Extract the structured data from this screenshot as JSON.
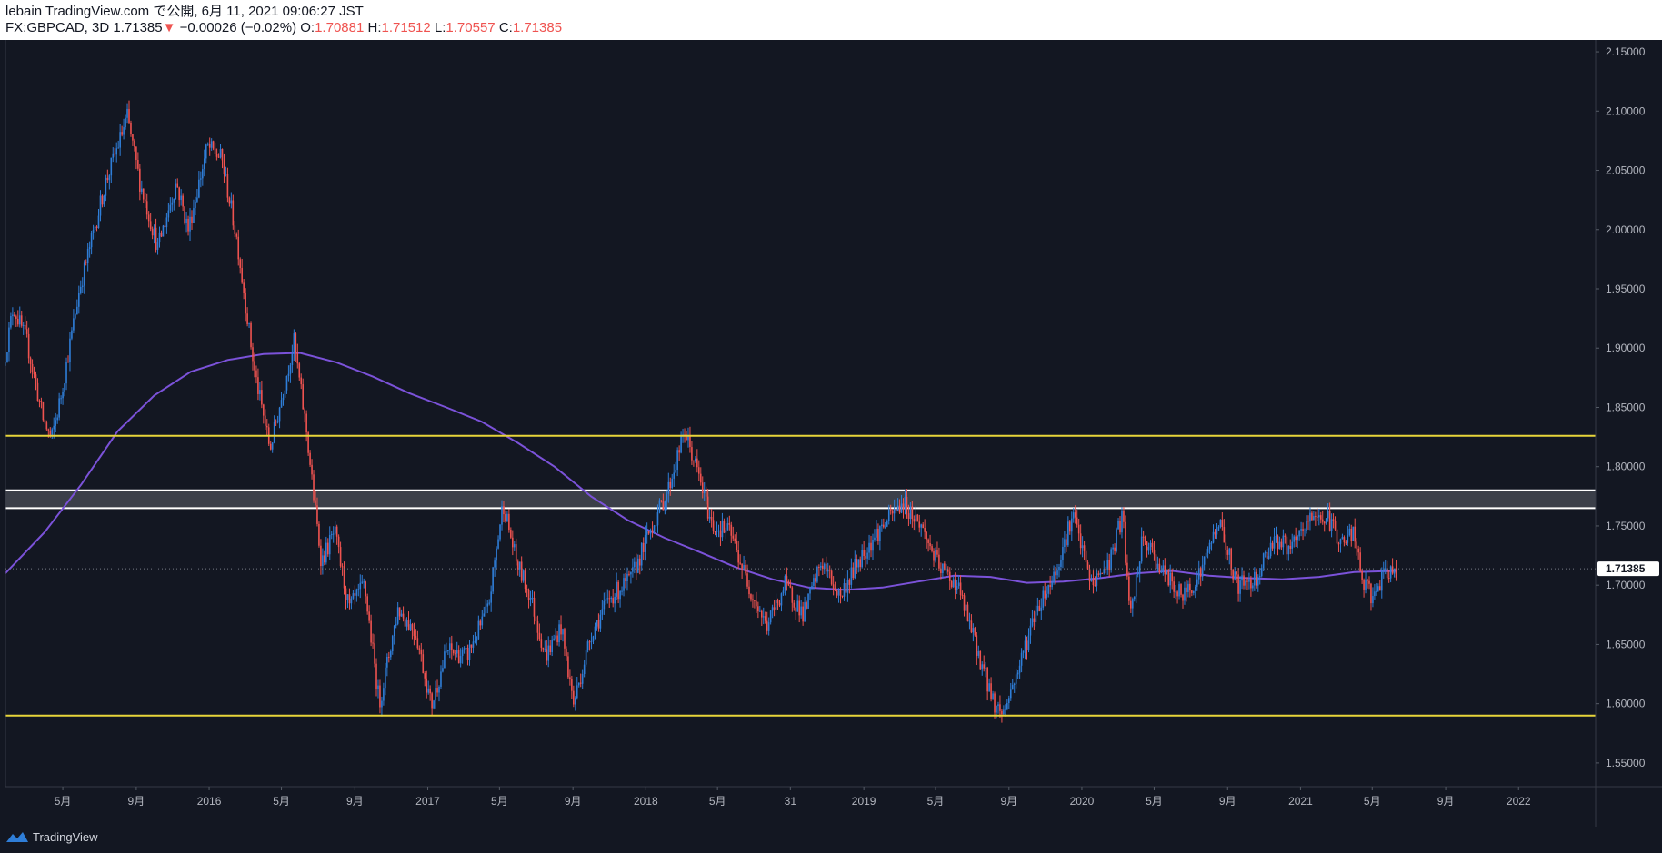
{
  "header": {
    "publisher": "lebain TradingView.com で公開, 6月 11, 2021 09:06:27 JST",
    "symbol": "FX:GBPCAD, 3D",
    "last": "1.71385",
    "change": "−0.00026 (−0.02%)",
    "open_label": "O:",
    "open": "1.70881",
    "high_label": "H:",
    "high": "1.71512",
    "low_label": "L:",
    "low": "1.70557",
    "close_label": "C:",
    "close": "1.71385"
  },
  "footer": {
    "brand": "TradingView",
    "logo_icon": "tradingview-logo-icon"
  },
  "colors": {
    "background": "#131722",
    "up": "#2f7ed8",
    "down": "#ef5350",
    "ma": "#7b52d9",
    "support_resistance": "#e8d53a",
    "zone_border": "#ffffff",
    "zone_fill": "#4a4d57",
    "price_tag": "#ffffff"
  },
  "chart_data": {
    "type": "candlestick",
    "symbol": "FX:GBPCAD",
    "timeframe": "3D",
    "ylim": [
      1.53,
      2.16
    ],
    "xlim": [
      "2015-01-25",
      "2022-05-10"
    ],
    "y_ticks": [
      "1.55000",
      "1.60000",
      "1.65000",
      "1.70000",
      "1.75000",
      "1.80000",
      "1.85000",
      "1.90000",
      "1.95000",
      "2.00000",
      "2.05000",
      "2.10000",
      "2.15000"
    ],
    "x_ticks": [
      {
        "label": "5月",
        "date": "2015-05-01"
      },
      {
        "label": "9月",
        "date": "2015-09-01"
      },
      {
        "label": "2016",
        "date": "2016-01-01"
      },
      {
        "label": "5月",
        "date": "2016-05-01"
      },
      {
        "label": "9月",
        "date": "2016-09-01"
      },
      {
        "label": "2017",
        "date": "2017-01-01"
      },
      {
        "label": "5月",
        "date": "2017-05-01"
      },
      {
        "label": "9月",
        "date": "2017-09-01"
      },
      {
        "label": "2018",
        "date": "2018-01-01"
      },
      {
        "label": "5月",
        "date": "2018-05-01"
      },
      {
        "label": "31",
        "date": "2018-08-31"
      },
      {
        "label": "2019",
        "date": "2019-01-01"
      },
      {
        "label": "5月",
        "date": "2019-05-01"
      },
      {
        "label": "9月",
        "date": "2019-09-01"
      },
      {
        "label": "2020",
        "date": "2020-01-01"
      },
      {
        "label": "5月",
        "date": "2020-05-01"
      },
      {
        "label": "9月",
        "date": "2020-09-01"
      },
      {
        "label": "2021",
        "date": "2021-01-01"
      },
      {
        "label": "5月",
        "date": "2021-05-01"
      },
      {
        "label": "9月",
        "date": "2021-09-01"
      },
      {
        "label": "2022",
        "date": "2022-01-01"
      }
    ],
    "last_price": 1.71385,
    "last_price_label": "1.71385",
    "price_path": [
      {
        "date": "2015-01-25",
        "price": 1.885
      },
      {
        "date": "2015-02-10",
        "price": 1.935
      },
      {
        "date": "2015-03-05",
        "price": 1.905
      },
      {
        "date": "2015-04-01",
        "price": 1.84
      },
      {
        "date": "2015-04-15",
        "price": 1.823
      },
      {
        "date": "2015-05-01",
        "price": 1.86
      },
      {
        "date": "2015-06-01",
        "price": 1.95
      },
      {
        "date": "2015-07-15",
        "price": 2.04
      },
      {
        "date": "2015-08-20",
        "price": 2.095
      },
      {
        "date": "2015-09-10",
        "price": 2.04
      },
      {
        "date": "2015-10-10",
        "price": 1.985
      },
      {
        "date": "2015-11-10",
        "price": 2.04
      },
      {
        "date": "2015-11-30",
        "price": 2.0
      },
      {
        "date": "2016-01-01",
        "price": 2.07
      },
      {
        "date": "2016-01-25",
        "price": 2.06
      },
      {
        "date": "2016-02-20",
        "price": 1.99
      },
      {
        "date": "2016-03-20",
        "price": 1.88
      },
      {
        "date": "2016-04-15",
        "price": 1.815
      },
      {
        "date": "2016-05-05",
        "price": 1.86
      },
      {
        "date": "2016-05-25",
        "price": 1.905
      },
      {
        "date": "2016-06-15",
        "price": 1.83
      },
      {
        "date": "2016-06-28",
        "price": 1.77
      },
      {
        "date": "2016-07-10",
        "price": 1.72
      },
      {
        "date": "2016-08-01",
        "price": 1.745
      },
      {
        "date": "2016-08-25",
        "price": 1.68
      },
      {
        "date": "2016-09-20",
        "price": 1.7
      },
      {
        "date": "2016-10-15",
        "price": 1.6
      },
      {
        "date": "2016-11-15",
        "price": 1.68
      },
      {
        "date": "2016-12-15",
        "price": 1.66
      },
      {
        "date": "2017-01-10",
        "price": 1.598
      },
      {
        "date": "2017-02-05",
        "price": 1.645
      },
      {
        "date": "2017-03-10",
        "price": 1.64
      },
      {
        "date": "2017-04-15",
        "price": 1.68
      },
      {
        "date": "2017-05-10",
        "price": 1.77
      },
      {
        "date": "2017-06-01",
        "price": 1.72
      },
      {
        "date": "2017-06-25",
        "price": 1.69
      },
      {
        "date": "2017-07-20",
        "price": 1.64
      },
      {
        "date": "2017-08-15",
        "price": 1.665
      },
      {
        "date": "2017-09-05",
        "price": 1.6
      },
      {
        "date": "2017-10-05",
        "price": 1.66
      },
      {
        "date": "2017-11-05",
        "price": 1.69
      },
      {
        "date": "2017-12-10",
        "price": 1.705
      },
      {
        "date": "2018-01-10",
        "price": 1.745
      },
      {
        "date": "2018-02-10",
        "price": 1.78
      },
      {
        "date": "2018-03-10",
        "price": 1.83
      },
      {
        "date": "2018-04-01",
        "price": 1.795
      },
      {
        "date": "2018-04-25",
        "price": 1.75
      },
      {
        "date": "2018-05-25",
        "price": 1.745
      },
      {
        "date": "2018-06-25",
        "price": 1.7
      },
      {
        "date": "2018-07-25",
        "price": 1.665
      },
      {
        "date": "2018-08-25",
        "price": 1.7
      },
      {
        "date": "2018-09-25",
        "price": 1.675
      },
      {
        "date": "2018-10-25",
        "price": 1.72
      },
      {
        "date": "2018-11-25",
        "price": 1.69
      },
      {
        "date": "2018-12-25",
        "price": 1.72
      },
      {
        "date": "2019-01-20",
        "price": 1.74
      },
      {
        "date": "2019-03-10",
        "price": 1.77
      },
      {
        "date": "2019-04-10",
        "price": 1.75
      },
      {
        "date": "2019-05-10",
        "price": 1.715
      },
      {
        "date": "2019-06-10",
        "price": 1.7
      },
      {
        "date": "2019-07-10",
        "price": 1.65
      },
      {
        "date": "2019-08-10",
        "price": 1.6
      },
      {
        "date": "2019-08-25",
        "price": 1.592
      },
      {
        "date": "2019-09-20",
        "price": 1.63
      },
      {
        "date": "2019-10-20",
        "price": 1.68
      },
      {
        "date": "2019-11-20",
        "price": 1.71
      },
      {
        "date": "2019-12-20",
        "price": 1.76
      },
      {
        "date": "2020-01-20",
        "price": 1.7
      },
      {
        "date": "2020-02-20",
        "price": 1.72
      },
      {
        "date": "2020-03-12",
        "price": 1.76
      },
      {
        "date": "2020-03-25",
        "price": 1.67
      },
      {
        "date": "2020-04-15",
        "price": 1.74
      },
      {
        "date": "2020-05-20",
        "price": 1.71
      },
      {
        "date": "2020-06-20",
        "price": 1.69
      },
      {
        "date": "2020-07-20",
        "price": 1.71
      },
      {
        "date": "2020-08-20",
        "price": 1.755
      },
      {
        "date": "2020-09-20",
        "price": 1.7
      },
      {
        "date": "2020-10-20",
        "price": 1.705
      },
      {
        "date": "2020-11-20",
        "price": 1.74
      },
      {
        "date": "2020-12-20",
        "price": 1.73
      },
      {
        "date": "2021-01-25",
        "price": 1.76
      },
      {
        "date": "2021-02-20",
        "price": 1.755
      },
      {
        "date": "2021-03-15",
        "price": 1.735
      },
      {
        "date": "2021-04-01",
        "price": 1.745
      },
      {
        "date": "2021-04-20",
        "price": 1.7
      },
      {
        "date": "2021-05-05",
        "price": 1.69
      },
      {
        "date": "2021-05-20",
        "price": 1.705
      },
      {
        "date": "2021-06-10",
        "price": 1.71385
      }
    ],
    "moving_average": [
      {
        "date": "2015-01-25",
        "price": 1.71
      },
      {
        "date": "2015-04-01",
        "price": 1.745
      },
      {
        "date": "2015-06-01",
        "price": 1.785
      },
      {
        "date": "2015-08-01",
        "price": 1.83
      },
      {
        "date": "2015-10-01",
        "price": 1.86
      },
      {
        "date": "2015-12-01",
        "price": 1.88
      },
      {
        "date": "2016-02-01",
        "price": 1.89
      },
      {
        "date": "2016-04-01",
        "price": 1.895
      },
      {
        "date": "2016-06-01",
        "price": 1.896
      },
      {
        "date": "2016-08-01",
        "price": 1.888
      },
      {
        "date": "2016-10-01",
        "price": 1.876
      },
      {
        "date": "2016-12-01",
        "price": 1.862
      },
      {
        "date": "2017-02-01",
        "price": 1.85
      },
      {
        "date": "2017-04-01",
        "price": 1.838
      },
      {
        "date": "2017-06-01",
        "price": 1.82
      },
      {
        "date": "2017-08-01",
        "price": 1.8
      },
      {
        "date": "2017-10-01",
        "price": 1.775
      },
      {
        "date": "2017-12-01",
        "price": 1.755
      },
      {
        "date": "2018-02-01",
        "price": 1.74
      },
      {
        "date": "2018-04-01",
        "price": 1.728
      },
      {
        "date": "2018-06-01",
        "price": 1.715
      },
      {
        "date": "2018-08-01",
        "price": 1.705
      },
      {
        "date": "2018-10-01",
        "price": 1.698
      },
      {
        "date": "2018-12-01",
        "price": 1.696
      },
      {
        "date": "2019-02-01",
        "price": 1.698
      },
      {
        "date": "2019-04-01",
        "price": 1.703
      },
      {
        "date": "2019-06-01",
        "price": 1.708
      },
      {
        "date": "2019-08-01",
        "price": 1.707
      },
      {
        "date": "2019-10-01",
        "price": 1.702
      },
      {
        "date": "2019-12-01",
        "price": 1.703
      },
      {
        "date": "2020-02-01",
        "price": 1.706
      },
      {
        "date": "2020-04-01",
        "price": 1.71
      },
      {
        "date": "2020-06-01",
        "price": 1.712
      },
      {
        "date": "2020-08-01",
        "price": 1.708
      },
      {
        "date": "2020-10-01",
        "price": 1.706
      },
      {
        "date": "2020-12-01",
        "price": 1.705
      },
      {
        "date": "2021-02-01",
        "price": 1.707
      },
      {
        "date": "2021-04-01",
        "price": 1.711
      },
      {
        "date": "2021-06-10",
        "price": 1.712
      }
    ],
    "horizontal_lines": [
      {
        "price": 1.826,
        "color": "#e8d53a"
      },
      {
        "price": 1.59,
        "color": "#e8d53a"
      }
    ],
    "zone": {
      "top": 1.78,
      "bottom": 1.765
    }
  }
}
